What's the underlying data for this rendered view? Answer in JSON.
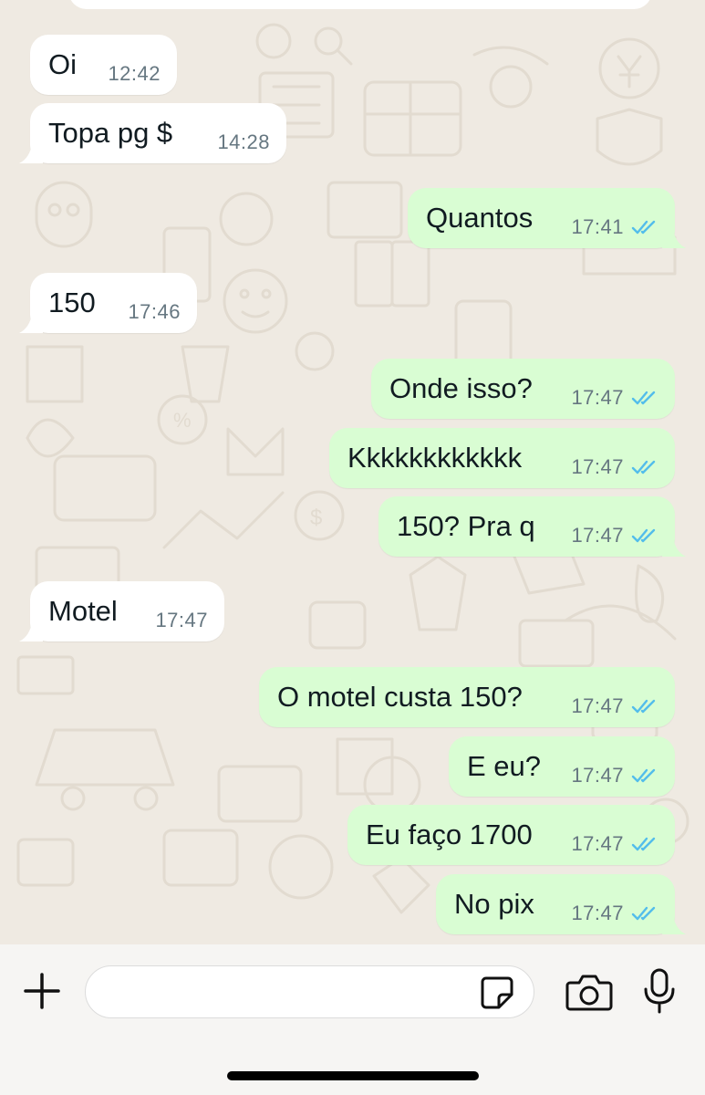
{
  "messages": [
    {
      "dir": "in",
      "text": "Oi",
      "time": "12:42"
    },
    {
      "dir": "in",
      "text": "Topa pg $",
      "time": "14:28"
    },
    {
      "dir": "out",
      "text": "Quantos",
      "time": "17:41",
      "status": "read"
    },
    {
      "dir": "in",
      "text": "150",
      "time": "17:46"
    },
    {
      "dir": "out",
      "text": "Onde isso?",
      "time": "17:47",
      "status": "read"
    },
    {
      "dir": "out",
      "text": "Kkkkkkkkkkkk",
      "time": "17:47",
      "status": "read"
    },
    {
      "dir": "out",
      "text": "150? Pra q",
      "time": "17:47",
      "status": "read"
    },
    {
      "dir": "in",
      "text": "Motel",
      "time": "17:47"
    },
    {
      "dir": "out",
      "text": "O motel custa 150?",
      "time": "17:47",
      "status": "read"
    },
    {
      "dir": "out",
      "text": "E eu?",
      "time": "17:47",
      "status": "read"
    },
    {
      "dir": "out",
      "text": "Eu faço 1700",
      "time": "17:47",
      "status": "read"
    },
    {
      "dir": "out",
      "text": "No pix",
      "time": "17:47",
      "status": "read"
    }
  ],
  "composer": {
    "placeholder": "",
    "value": "",
    "icons": {
      "attach": "plus-icon",
      "sticker": "sticker-icon",
      "camera": "camera-icon",
      "mic": "microphone-icon"
    }
  },
  "colors": {
    "chat_background": "#efeae2",
    "incoming_bubble": "#ffffff",
    "outgoing_bubble": "#d9fdd3",
    "read_ticks": "#53bdeb",
    "timestamp": "#667781"
  }
}
